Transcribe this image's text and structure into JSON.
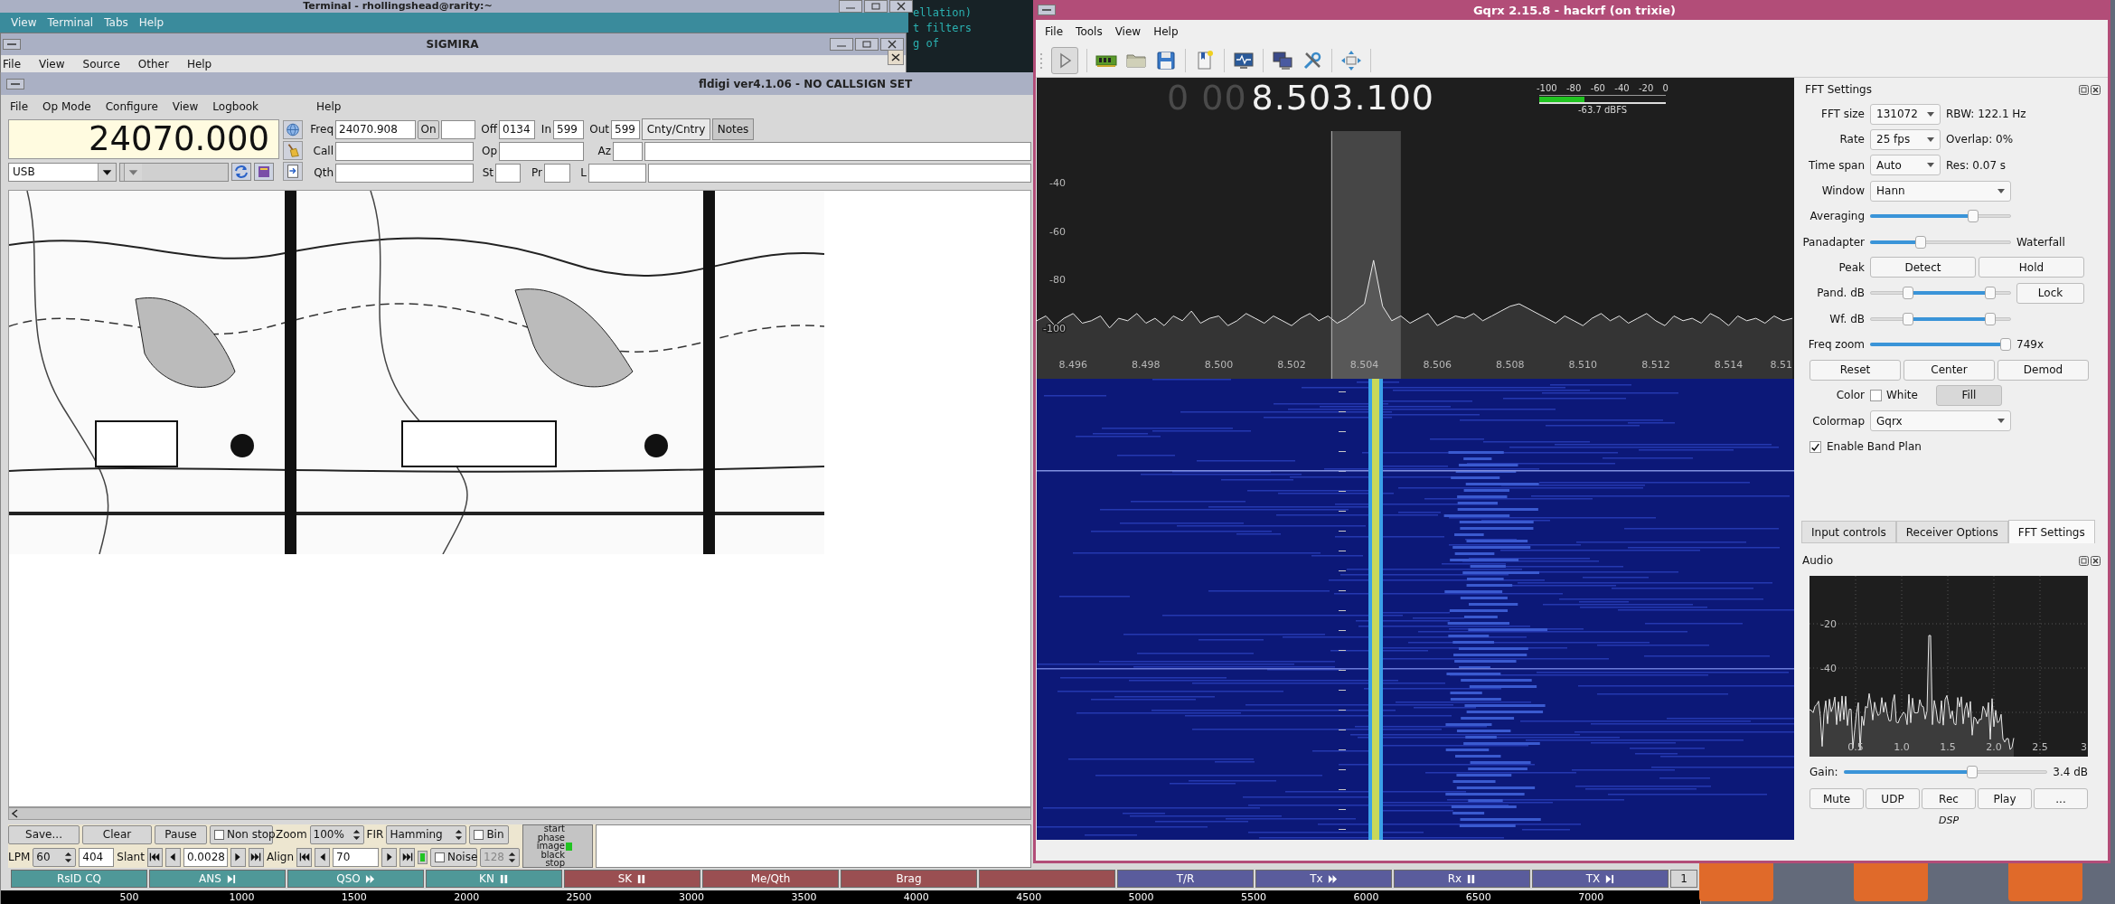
{
  "terminal": {
    "title": "Terminal - rhollingshead@rarity:~",
    "menu": [
      "View",
      "Terminal",
      "Tabs",
      "Help"
    ],
    "output_lines": [
      "ellation)",
      "t filters",
      "g of"
    ]
  },
  "sigmira": {
    "title": "SIGMIRA",
    "menu": [
      "File",
      "View",
      "Source",
      "Other",
      "Help"
    ]
  },
  "fldigi": {
    "title": "fldigi ver4.1.06 - NO CALLSIGN SET",
    "menu": [
      "File",
      "Op Mode",
      "Configure",
      "View",
      "Logbook",
      "Help"
    ],
    "frequency": "24070.000",
    "mode": "USB",
    "freq_row": {
      "freq_label": "Freq",
      "freq_value": "24070.908",
      "on_button": "On",
      "off_label": "Off",
      "off_value": "0134",
      "in_label": "In",
      "in_value": "599",
      "out_label": "Out",
      "out_value": "599"
    },
    "tabs": [
      {
        "label": "Cnty/Cntry",
        "selected": true
      },
      {
        "label": "Notes",
        "selected": false
      }
    ],
    "call_row": {
      "call_label": "Call",
      "op_label": "Op",
      "az_label": "Az"
    },
    "qth_row": {
      "qth_label": "Qth",
      "st_label": "St",
      "pr_label": "Pr",
      "l_label": "L"
    },
    "controls": {
      "buttons": [
        "Save...",
        "Clear",
        "Pause"
      ],
      "non_stop": {
        "label": "Non stop",
        "checked": false
      },
      "zoom": {
        "label": "Zoom",
        "value": "100%"
      },
      "fir": {
        "label": "FIR",
        "value": "Hamming"
      },
      "bin": {
        "label": "Bin",
        "checked": false
      },
      "phase_note": "start phase image black stop",
      "lpm": {
        "label": "LPM",
        "value": "60"
      },
      "lpm_field": "404",
      "slant": {
        "label": "Slant",
        "value": "0.0028"
      },
      "align": {
        "label": "Align",
        "value": "70"
      },
      "noise": {
        "label": "Noise",
        "checked": false
      },
      "depth": {
        "value": "128",
        "disabled": true
      }
    },
    "macros": [
      {
        "label": "RsID CQ",
        "color": "#4f9898"
      },
      {
        "label": "ANS",
        "kind": "skip",
        "color": "#4f9898"
      },
      {
        "label": "QSO",
        "kind": "fast",
        "color": "#4f9898"
      },
      {
        "label": "KN",
        "kind": "pause",
        "color": "#4f9898"
      },
      {
        "label": "SK",
        "kind": "pause",
        "color": "#9a4f52"
      },
      {
        "label": "Me/Qth",
        "color": "#9a4f52"
      },
      {
        "label": "Brag",
        "color": "#9a4f52"
      },
      {
        "color": "#9a4f52"
      },
      {
        "label": "T/R",
        "color": "#5a5c9c"
      },
      {
        "label": "Tx",
        "kind": "fast",
        "color": "#5a5c9c"
      },
      {
        "label": "Rx",
        "kind": "pause",
        "color": "#5a5c9c"
      },
      {
        "label": "TX",
        "kind": "skip",
        "color": "#5a5c9c"
      }
    ],
    "macro_page": "1",
    "ruler": [
      "500",
      "1000",
      "1500",
      "2000",
      "2500",
      "3000",
      "3500",
      "4000",
      "4500",
      "5000",
      "5500",
      "6000",
      "6500",
      "7000"
    ]
  },
  "gqrx": {
    "title": "Gqrx 2.15.8 - hackrf (on trixie)",
    "menu": [
      "File",
      "Tools",
      "View",
      "Help"
    ],
    "frequency_dim": "0 00",
    "frequency": "8.503.100",
    "meter": {
      "scale": [
        "-100",
        "-80",
        "-60",
        "-40",
        "-20",
        "0"
      ],
      "level": 0.36,
      "reading": "-63.7 dBFS"
    },
    "spectrum": {
      "chart_data": {
        "type": "area",
        "xlim": [
          8.495,
          8.5158
        ],
        "ylim": [
          -121,
          3.5
        ],
        "bands": [
          {
            "axis": "x",
            "from": 8.5031,
            "to": 8.505
          }
        ],
        "ref_lines": [
          {
            "axis": "x",
            "value": 8.5031,
            "color": "#bbbbbb"
          }
        ],
        "yticks": [
          -40,
          -60,
          -80,
          -100
        ],
        "xticks": [
          {
            "value": 8.496,
            "label": "8.496"
          },
          {
            "value": 8.498,
            "label": "8.498"
          },
          {
            "value": 8.5,
            "label": "8.500"
          },
          {
            "value": 8.502,
            "label": "8.502"
          },
          {
            "value": 8.504,
            "label": "8.504"
          },
          {
            "value": 8.506,
            "label": "8.506"
          },
          {
            "value": 8.508,
            "label": "8.508"
          },
          {
            "value": 8.51,
            "label": "8.510"
          },
          {
            "value": 8.512,
            "label": "8.512"
          },
          {
            "value": 8.514,
            "label": "8.514"
          }
        ],
        "x": [
          8.495,
          8.49525,
          8.4955,
          8.49575,
          8.496,
          8.49625,
          8.4965,
          8.49675,
          8.497,
          8.49725,
          8.4975,
          8.49775,
          8.498,
          8.49825,
          8.4985,
          8.49875,
          8.499,
          8.49925,
          8.4995,
          8.49975,
          8.5,
          8.50025,
          8.5005,
          8.50075,
          8.501,
          8.50125,
          8.5015,
          8.50175,
          8.502,
          8.50225,
          8.5025,
          8.50275,
          8.503,
          8.50325,
          8.5035,
          8.50375,
          8.504,
          8.50425,
          8.5045,
          8.50475,
          8.505,
          8.50525,
          8.5055,
          8.50575,
          8.506,
          8.50625,
          8.5065,
          8.50675,
          8.507,
          8.50725,
          8.5075,
          8.50775,
          8.508,
          8.50825,
          8.5085,
          8.50875,
          8.509,
          8.50925,
          8.5095,
          8.50975,
          8.51,
          8.51025,
          8.5105,
          8.51075,
          8.511,
          8.51125,
          8.5115,
          8.51175,
          8.512,
          8.51225,
          8.5125,
          8.51275,
          8.513,
          8.51325,
          8.5135,
          8.51375,
          8.514,
          8.51425,
          8.5145,
          8.51475,
          8.515,
          8.51525,
          8.5155,
          8.51575
        ],
        "series": [
          {
            "color": "#e8e8e8",
            "values": [
              -97,
              -95,
              -99,
              -96,
              -94,
              -98,
              -97,
              -95,
              -100,
              -96,
              -97,
              -94,
              -98,
              -96,
              -99,
              -95,
              -97,
              -93,
              -98,
              -96,
              -95,
              -99,
              -97,
              -94,
              -96,
              -98,
              -95,
              -97,
              -99,
              -96,
              -94,
              -97,
              -95,
              -98,
              -96,
              -93,
              -90,
              -72,
              -91,
              -97,
              -95,
              -98,
              -96,
              -94,
              -99,
              -97,
              -95,
              -96,
              -94,
              -97,
              -95,
              -93,
              -91,
              -90,
              -92,
              -94,
              -96,
              -98,
              -95,
              -97,
              -99,
              -96,
              -94,
              -97,
              -95,
              -98,
              -96,
              -94,
              -97,
              -99,
              -95,
              -97,
              -96,
              -98,
              -94,
              -96,
              -99,
              -95,
              -97,
              -96,
              -98,
              -95,
              -97,
              -96
            ]
          }
        ]
      },
      "edge_label": "8.51"
    },
    "fft_settings": {
      "title": "FFT Settings",
      "rows": [
        {
          "kind": "combo",
          "label": "FFT size",
          "value": "131072",
          "note": "RBW: 122.1 Hz"
        },
        {
          "kind": "combo",
          "label": "Rate",
          "value": "25 fps",
          "note": "Overlap: 0%"
        },
        {
          "kind": "combo",
          "label": "Time span",
          "value": "Auto",
          "note": "Res: 0.07 s"
        },
        {
          "kind": "wide_combo",
          "label": "Window",
          "value": "Hann"
        },
        {
          "kind": "slider",
          "label": "Averaging",
          "level": 0.73
        },
        {
          "kind": "slider",
          "label": "Panadapter",
          "level": 0.36,
          "note": "Waterfall"
        },
        {
          "kind": "buttons",
          "label": "Peak",
          "buttons": [
            "Detect",
            "Hold"
          ]
        },
        {
          "kind": "range",
          "label": "Pand. dB",
          "thumbs": [
            {
              "level": 0.27
            },
            {
              "level": 0.85
            }
          ],
          "button": "Lock"
        },
        {
          "kind": "range",
          "label": "Wf. dB",
          "thumbs": [
            {
              "level": 0.27
            },
            {
              "level": 0.85
            }
          ]
        },
        {
          "kind": "slider",
          "label": "Freq zoom",
          "level": 0.96,
          "note": "749x"
        },
        {
          "kind": "button_bar",
          "buttons": [
            "Reset",
            "Center",
            "Demod"
          ]
        },
        {
          "kind": "color",
          "label": "Color",
          "checkbox": {
            "label": "White",
            "checked": false
          },
          "toggle": {
            "label": "Fill",
            "on": true
          }
        },
        {
          "kind": "wide_combo",
          "label": "Colormap",
          "value": "Gqrx"
        },
        {
          "kind": "check",
          "label": "Enable Band Plan",
          "checked": true
        }
      ]
    },
    "dock_tabs": [
      {
        "label": "Input controls",
        "selected": false
      },
      {
        "label": "Receiver Options",
        "selected": false
      },
      {
        "label": "FFT Settings",
        "selected": true
      }
    ],
    "audio": {
      "title": "Audio",
      "y_labels": [
        "-20",
        "-40"
      ],
      "x_labels": [
        "0.5",
        "1.0",
        "1.5",
        "2.0",
        "2.5",
        "3"
      ],
      "gain": {
        "label": "Gain:",
        "level": 0.63,
        "reading": "3.4 dB"
      },
      "buttons": [
        "Mute",
        "UDP",
        "Rec",
        "Play",
        "..."
      ],
      "footer": "DSP"
    }
  }
}
